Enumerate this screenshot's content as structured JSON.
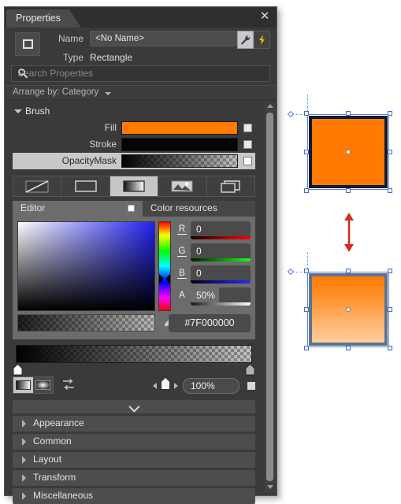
{
  "panel": {
    "title": "Properties",
    "close_icon": "close-icon",
    "element_icon": "rectangle-icon",
    "name_label": "Name",
    "name_value": "<No Name>",
    "type_label": "Type",
    "type_value": "Rectangle",
    "tool_buttons": [
      {
        "icon": "wrench-icon",
        "selected": true
      },
      {
        "icon": "lightning-icon",
        "selected": false
      }
    ],
    "search_placeholder": "Search Properties",
    "search_icon": "search-icon",
    "arrange_by": "Arrange by: Category"
  },
  "brush": {
    "category_label": "Brush",
    "rows": [
      {
        "label": "Fill",
        "swatch": "solid-orange",
        "color": "#FF7A00",
        "checked": true
      },
      {
        "label": "Stroke",
        "swatch": "solid-black",
        "color": "#050505",
        "checked": true
      },
      {
        "label": "OpacityMask",
        "swatch": "gradient-black-transparent",
        "color": "#000000",
        "checked": true,
        "highlighted": true
      }
    ],
    "brush_types": [
      {
        "name": "no-brush-icon",
        "selected": false
      },
      {
        "name": "solid-color-brush-icon",
        "selected": false
      },
      {
        "name": "gradient-brush-icon",
        "selected": true
      },
      {
        "name": "tile-brush-icon",
        "selected": false
      },
      {
        "name": "brush-resources-icon",
        "selected": false
      }
    ],
    "editor_tabs": [
      {
        "label": "Editor",
        "selected": true
      },
      {
        "label": "Color resources",
        "selected": false
      }
    ]
  },
  "color_editor": {
    "channels": [
      {
        "label": "R",
        "value": "0",
        "track_color": "#ff0000"
      },
      {
        "label": "G",
        "value": "0",
        "track_color": "#00ff00"
      },
      {
        "label": "B",
        "value": "0",
        "track_color": "#2222ff"
      },
      {
        "label": "A",
        "value": "50%",
        "track_color": "#ffffff"
      }
    ],
    "hex_value": "#7F000000",
    "eyedropper_icon": "eyedropper-icon",
    "swap_icon": "swap-colors-icon"
  },
  "gradient": {
    "stops": [
      {
        "position": "0%",
        "selected": true
      },
      {
        "position": "100%",
        "selected": false
      }
    ],
    "type_toggles": [
      {
        "name": "linear-gradient-icon",
        "selected": true
      },
      {
        "name": "radial-gradient-icon",
        "selected": false
      }
    ],
    "reverse_icon": "reverse-gradient-icon",
    "offset_value": "100%",
    "prev_stop_icon": "prev-stop-arrow",
    "next_stop_icon": "next-stop-arrow"
  },
  "collapse_bar_icon": "chevron-down-icon",
  "categories": [
    {
      "label": "Appearance"
    },
    {
      "label": "Common"
    },
    {
      "label": "Layout"
    },
    {
      "label": "Transform"
    },
    {
      "label": "Miscellaneous"
    }
  ],
  "scrollbar": {
    "up_icon": "scroll-up-arrow",
    "down_icon": "scroll-down-arrow"
  },
  "canvas": {
    "shapes": [
      {
        "name": "rectangle-solid-fill",
        "fill": "#FF7A00",
        "stroke": "#0d1a33",
        "gradient": false
      },
      {
        "name": "rectangle-opacity-masked",
        "fill_top": "#FF7A00",
        "fill_bottom": "#FFC78E",
        "stroke": "#5b7391",
        "gradient": true
      }
    ],
    "arrow": {
      "name": "double-arrow-icon",
      "color": "#d62e18"
    }
  }
}
